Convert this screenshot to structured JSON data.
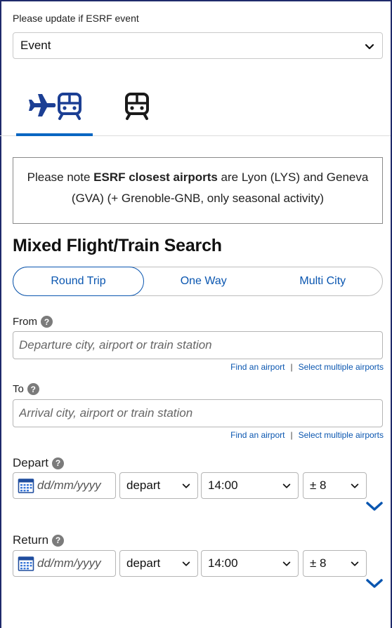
{
  "event": {
    "label": "Please update if ESRF event",
    "selected": "Event"
  },
  "tabs": [
    {
      "name": "flight-train",
      "icon": "plane-train-icon",
      "active": true
    },
    {
      "name": "train",
      "icon": "train-icon",
      "active": false
    }
  ],
  "notice": {
    "prefix": "Please note ",
    "bold": "ESRF closest airports",
    "suffix": " are Lyon (LYS) and Geneva (GVA) (+ Grenoble-GNB, only seasonal activity)"
  },
  "search": {
    "title": "Mixed Flight/Train Search",
    "trip_types": [
      "Round Trip",
      "One Way",
      "Multi City"
    ],
    "active_trip": "Round Trip"
  },
  "from": {
    "label": "From",
    "placeholder": "Departure city, airport or train station",
    "find_link": "Find an airport",
    "separator": "|",
    "multi_link": "Select multiple airports"
  },
  "to": {
    "label": "To",
    "placeholder": "Arrival city, airport or train station",
    "find_link": "Find an airport",
    "separator": "|",
    "multi_link": "Select multiple airports"
  },
  "depart": {
    "label": "Depart",
    "date_placeholder": "dd/mm/yyyy",
    "type": "depart",
    "time": "14:00",
    "flex": "± 8"
  },
  "return": {
    "label": "Return",
    "date_placeholder": "dd/mm/yyyy",
    "type": "depart",
    "time": "14:00",
    "flex": "± 8"
  },
  "colors": {
    "accent": "#0a56b0",
    "tab_underline": "#0a66c2",
    "nav_icon": "#1c3f94",
    "frame": "#1f2a6b"
  }
}
